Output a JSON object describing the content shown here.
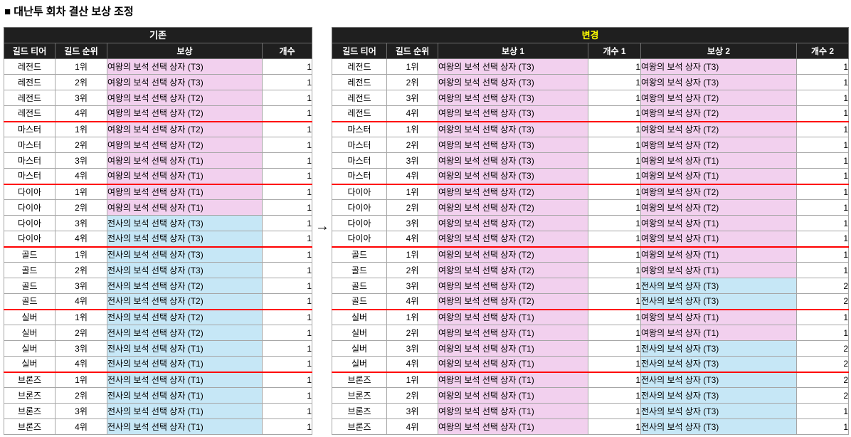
{
  "page_title": "■ 대난투 회차 결산 보상 조정",
  "arrow_glyph": "→",
  "colors": {
    "header_bg": "#1f1f1f",
    "header_text": "#ffffff",
    "changed_title_text": "#ffff00",
    "queen_reward_bg": "#f2d0ee",
    "warrior_reward_bg": "#c6e7f6",
    "tier_separator": "#ff0000",
    "grid_line": "#a6a6a6"
  },
  "existing_table": {
    "title": "기존",
    "columns": [
      "길드 티어",
      "길드 순위",
      "보상",
      "개수"
    ],
    "rows": [
      [
        "레전드",
        "1위",
        "여왕의 보석 선택 상자 (T3)",
        "queen",
        "1"
      ],
      [
        "레전드",
        "2위",
        "여왕의 보석 선택 상자 (T3)",
        "queen",
        "1"
      ],
      [
        "레전드",
        "3위",
        "여왕의 보석 선택 상자 (T2)",
        "queen",
        "1"
      ],
      [
        "레전드",
        "4위",
        "여왕의 보석 선택 상자 (T2)",
        "queen",
        "1"
      ],
      [
        "마스터",
        "1위",
        "여왕의 보석 선택 상자 (T2)",
        "queen",
        "1"
      ],
      [
        "마스터",
        "2위",
        "여왕의 보석 선택 상자 (T2)",
        "queen",
        "1"
      ],
      [
        "마스터",
        "3위",
        "여왕의 보석 선택 상자 (T1)",
        "queen",
        "1"
      ],
      [
        "마스터",
        "4위",
        "여왕의 보석 선택 상자 (T1)",
        "queen",
        "1"
      ],
      [
        "다이아",
        "1위",
        "여왕의 보석 선택 상자 (T1)",
        "queen",
        "1"
      ],
      [
        "다이아",
        "2위",
        "여왕의 보석 선택 상자 (T1)",
        "queen",
        "1"
      ],
      [
        "다이아",
        "3위",
        "전사의 보석 선택 상자 (T3)",
        "warrior",
        "1"
      ],
      [
        "다이아",
        "4위",
        "전사의 보석 선택 상자 (T3)",
        "warrior",
        "1"
      ],
      [
        "골드",
        "1위",
        "전사의 보석 선택 상자 (T3)",
        "warrior",
        "1"
      ],
      [
        "골드",
        "2위",
        "전사의 보석 선택 상자 (T3)",
        "warrior",
        "1"
      ],
      [
        "골드",
        "3위",
        "전사의 보석 선택 상자 (T2)",
        "warrior",
        "1"
      ],
      [
        "골드",
        "4위",
        "전사의 보석 선택 상자 (T2)",
        "warrior",
        "1"
      ],
      [
        "실버",
        "1위",
        "전사의 보석 선택 상자 (T2)",
        "warrior",
        "1"
      ],
      [
        "실버",
        "2위",
        "전사의 보석 선택 상자 (T2)",
        "warrior",
        "1"
      ],
      [
        "실버",
        "3위",
        "전사의 보석 선택 상자 (T1)",
        "warrior",
        "1"
      ],
      [
        "실버",
        "4위",
        "전사의 보석 선택 상자 (T1)",
        "warrior",
        "1"
      ],
      [
        "브론즈",
        "1위",
        "전사의 보석 선택 상자 (T1)",
        "warrior",
        "1"
      ],
      [
        "브론즈",
        "2위",
        "전사의 보석 선택 상자 (T1)",
        "warrior",
        "1"
      ],
      [
        "브론즈",
        "3위",
        "전사의 보석 선택 상자 (T1)",
        "warrior",
        "1"
      ],
      [
        "브론즈",
        "4위",
        "전사의 보석 선택 상자 (T1)",
        "warrior",
        "1"
      ]
    ]
  },
  "changed_table": {
    "title": "변경",
    "columns": [
      "길드 티어",
      "길드 순위",
      "보상 1",
      "개수 1",
      "보상 2",
      "개수 2"
    ],
    "rows": [
      [
        "레전드",
        "1위",
        "여왕의 보석 선택 상자 (T3)",
        "queen",
        "1",
        "여왕의 보석 상자 (T3)",
        "queen",
        "1"
      ],
      [
        "레전드",
        "2위",
        "여왕의 보석 선택 상자 (T3)",
        "queen",
        "1",
        "여왕의 보석 상자 (T3)",
        "queen",
        "1"
      ],
      [
        "레전드",
        "3위",
        "여왕의 보석 선택 상자 (T3)",
        "queen",
        "1",
        "여왕의 보석 상자 (T2)",
        "queen",
        "1"
      ],
      [
        "레전드",
        "4위",
        "여왕의 보석 선택 상자 (T3)",
        "queen",
        "1",
        "여왕의 보석 상자 (T2)",
        "queen",
        "1"
      ],
      [
        "마스터",
        "1위",
        "여왕의 보석 선택 상자 (T3)",
        "queen",
        "1",
        "여왕의 보석 상자 (T2)",
        "queen",
        "1"
      ],
      [
        "마스터",
        "2위",
        "여왕의 보석 선택 상자 (T3)",
        "queen",
        "1",
        "여왕의 보석 상자 (T2)",
        "queen",
        "1"
      ],
      [
        "마스터",
        "3위",
        "여왕의 보석 선택 상자 (T3)",
        "queen",
        "1",
        "여왕의 보석 상자 (T1)",
        "queen",
        "1"
      ],
      [
        "마스터",
        "4위",
        "여왕의 보석 선택 상자 (T3)",
        "queen",
        "1",
        "여왕의 보석 상자 (T1)",
        "queen",
        "1"
      ],
      [
        "다이아",
        "1위",
        "여왕의 보석 선택 상자 (T2)",
        "queen",
        "1",
        "여왕의 보석 상자 (T2)",
        "queen",
        "1"
      ],
      [
        "다이아",
        "2위",
        "여왕의 보석 선택 상자 (T2)",
        "queen",
        "1",
        "여왕의 보석 상자 (T2)",
        "queen",
        "1"
      ],
      [
        "다이아",
        "3위",
        "여왕의 보석 선택 상자 (T2)",
        "queen",
        "1",
        "여왕의 보석 상자 (T1)",
        "queen",
        "1"
      ],
      [
        "다이아",
        "4위",
        "여왕의 보석 선택 상자 (T2)",
        "queen",
        "1",
        "여왕의 보석 상자 (T1)",
        "queen",
        "1"
      ],
      [
        "골드",
        "1위",
        "여왕의 보석 선택 상자 (T2)",
        "queen",
        "1",
        "여왕의 보석 상자 (T1)",
        "queen",
        "1"
      ],
      [
        "골드",
        "2위",
        "여왕의 보석 선택 상자 (T2)",
        "queen",
        "1",
        "여왕의 보석 상자 (T1)",
        "queen",
        "1"
      ],
      [
        "골드",
        "3위",
        "여왕의 보석 선택 상자 (T2)",
        "queen",
        "1",
        "전사의 보석 상자 (T3)",
        "warrior",
        "2"
      ],
      [
        "골드",
        "4위",
        "여왕의 보석 선택 상자 (T2)",
        "queen",
        "1",
        "전사의 보석 상자 (T3)",
        "warrior",
        "2"
      ],
      [
        "실버",
        "1위",
        "여왕의 보석 선택 상자 (T1)",
        "queen",
        "1",
        "여왕의 보석 상자 (T1)",
        "queen",
        "1"
      ],
      [
        "실버",
        "2위",
        "여왕의 보석 선택 상자 (T1)",
        "queen",
        "1",
        "여왕의 보석 상자 (T1)",
        "queen",
        "1"
      ],
      [
        "실버",
        "3위",
        "여왕의 보석 선택 상자 (T1)",
        "queen",
        "1",
        "전사의 보석 상자 (T3)",
        "warrior",
        "2"
      ],
      [
        "실버",
        "4위",
        "여왕의 보석 선택 상자 (T1)",
        "queen",
        "1",
        "전사의 보석 상자 (T3)",
        "warrior",
        "2"
      ],
      [
        "브론즈",
        "1위",
        "여왕의 보석 선택 상자 (T1)",
        "queen",
        "1",
        "전사의 보석 상자 (T3)",
        "warrior",
        "2"
      ],
      [
        "브론즈",
        "2위",
        "여왕의 보석 선택 상자 (T1)",
        "queen",
        "1",
        "전사의 보석 상자 (T3)",
        "warrior",
        "2"
      ],
      [
        "브론즈",
        "3위",
        "여왕의 보석 선택 상자 (T1)",
        "queen",
        "1",
        "전사의 보석 상자 (T3)",
        "warrior",
        "1"
      ],
      [
        "브론즈",
        "4위",
        "여왕의 보석 선택 상자 (T1)",
        "queen",
        "1",
        "전사의 보석 상자 (T3)",
        "warrior",
        "1"
      ]
    ]
  },
  "tier_group_size": 4
}
